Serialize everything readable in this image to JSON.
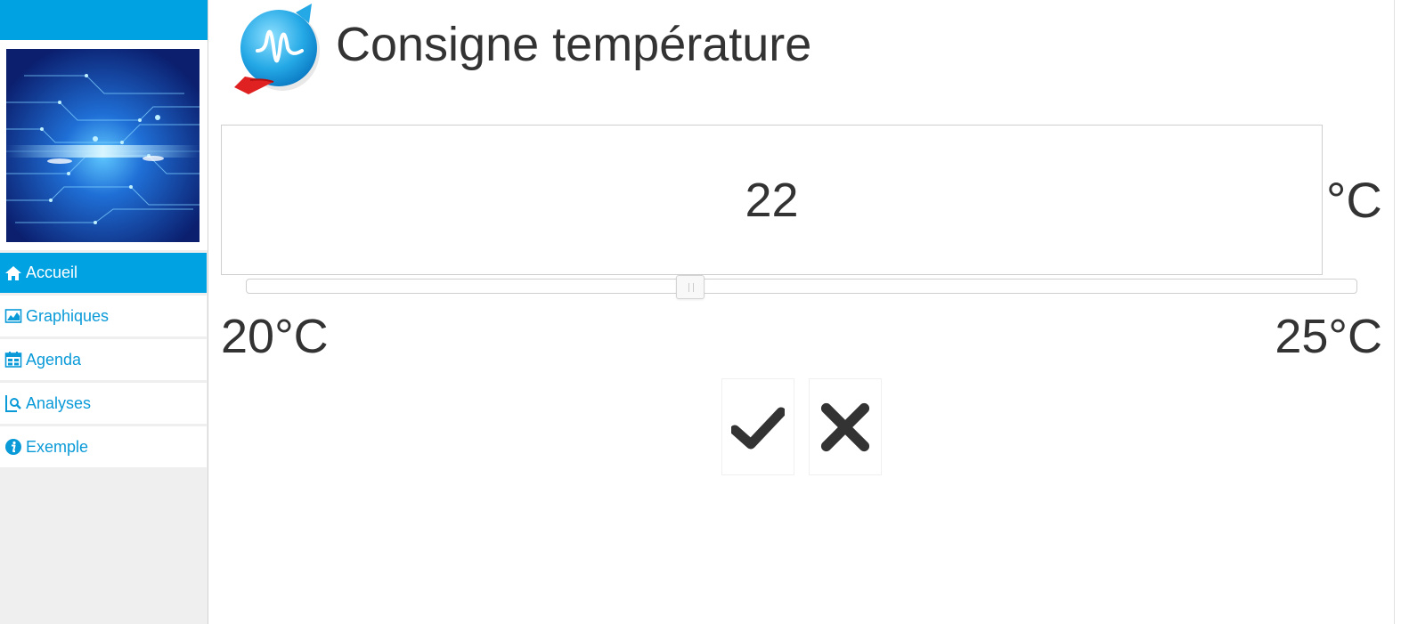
{
  "page": {
    "title": "Consigne température"
  },
  "sidebar": {
    "items": [
      {
        "label": "Accueil",
        "icon": "home-icon",
        "active": true
      },
      {
        "label": "Graphiques",
        "icon": "chart-icon",
        "active": false
      },
      {
        "label": "Agenda",
        "icon": "calendar-icon",
        "active": false
      },
      {
        "label": "Analyses",
        "icon": "search-report-icon",
        "active": false
      },
      {
        "label": "Exemple",
        "icon": "info-icon",
        "active": false
      }
    ]
  },
  "setpoint": {
    "value": "22",
    "unit": "°C",
    "min": 20,
    "max": 25,
    "current": 22,
    "min_label": "20°C",
    "max_label": "25°C"
  },
  "colors": {
    "accent": "#00a2e1",
    "text": "#333333",
    "link": "#0a9ad8",
    "sidebar_bg": "#efefef"
  },
  "actions": {
    "confirm_icon": "check-icon",
    "cancel_icon": "close-icon"
  }
}
